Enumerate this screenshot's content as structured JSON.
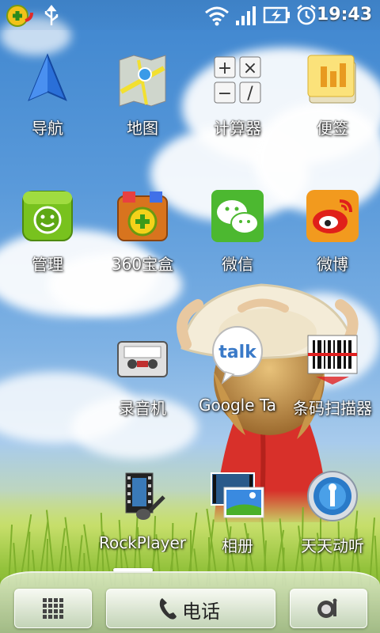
{
  "status_bar": {
    "time": "19:43",
    "icons": [
      "360-security-icon",
      "usb-icon",
      "wifi-icon",
      "signal-icon",
      "battery-charging-icon",
      "alarm-icon"
    ]
  },
  "apps": [
    {
      "label": "导航",
      "icon": "navigation-arrow-icon"
    },
    {
      "label": "地图",
      "icon": "maps-icon"
    },
    {
      "label": "计算器",
      "icon": "calculator-icon"
    },
    {
      "label": "便签",
      "icon": "notes-icon"
    },
    {
      "label": "管理",
      "icon": "manager-icon"
    },
    {
      "label": "360宝盒",
      "icon": "360-box-icon"
    },
    {
      "label": "微信",
      "icon": "wechat-icon"
    },
    {
      "label": "微博",
      "icon": "weibo-icon"
    },
    {
      "label": "录音机",
      "icon": "cassette-recorder-icon"
    },
    {
      "label": "Google Ta",
      "icon": "google-talk-icon"
    },
    {
      "label": "条码扫描器",
      "icon": "barcode-scanner-icon"
    },
    {
      "label": "RockPlayer",
      "icon": "rockplayer-icon"
    },
    {
      "label": "相册",
      "icon": "gallery-icon"
    },
    {
      "label": "天天动听",
      "icon": "ttpod-icon"
    }
  ],
  "dock": {
    "apps_button_icon": "app-drawer-grid-icon",
    "phone_label": "电话",
    "phone_icon": "phone-handset-icon",
    "browser_icon": "browser-icon"
  },
  "icon_text": {
    "talk": "talk",
    "calc_plus": "+",
    "calc_times": "×",
    "calc_minus": "−",
    "calc_div": "/"
  }
}
